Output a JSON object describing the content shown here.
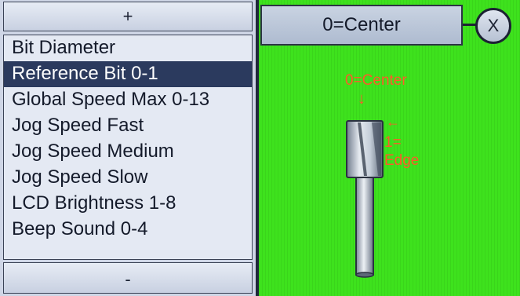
{
  "menu": {
    "scroll_up_label": "+",
    "scroll_down_label": "-",
    "items": [
      {
        "label": "Bit Diameter"
      },
      {
        "label": "Reference Bit 0-1"
      },
      {
        "label": "Global Speed Max 0-13"
      },
      {
        "label": "Jog Speed Fast"
      },
      {
        "label": "Jog Speed Medium"
      },
      {
        "label": "Jog Speed Slow"
      },
      {
        "label": "LCD Brightness 1-8"
      },
      {
        "label": "Beep Sound 0-4"
      }
    ],
    "selected_item": "Reference Bit 0-1"
  },
  "setting": {
    "value_display": "0=Center",
    "close_label": "X"
  },
  "illustration": {
    "center_label": "0=Center",
    "edge_label_line1": "1=",
    "edge_label_line2": "Edge",
    "arrow_down": "↓",
    "arrow_left": "←"
  },
  "colors": {
    "background_green": "#3ee21d",
    "selected_row": "#2b3a5e",
    "annotation_orange": "#ff5a2a"
  }
}
